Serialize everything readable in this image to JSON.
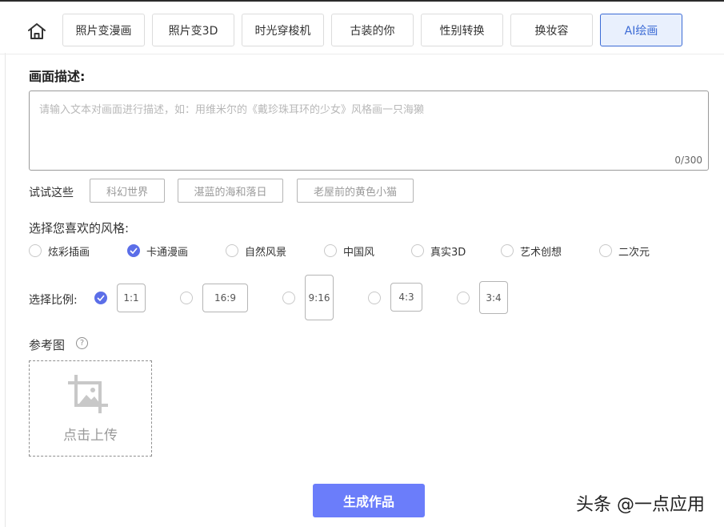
{
  "tabs": [
    {
      "label": "照片变漫画"
    },
    {
      "label": "照片变3D"
    },
    {
      "label": "时光穿梭机"
    },
    {
      "label": "古装的你"
    },
    {
      "label": "性别转换"
    },
    {
      "label": "换妆容"
    },
    {
      "label": "AI绘画",
      "active": true
    }
  ],
  "description": {
    "title": "画面描述:",
    "placeholder": "请输入文本对画面进行描述，如：用维米尔的《戴珍珠耳环的少女》风格画一只海獭",
    "value": "",
    "counter": "0/300"
  },
  "try": {
    "label": "试试这些",
    "chips": [
      "科幻世界",
      "湛蓝的海和落日",
      "老屋前的黄色小猫"
    ]
  },
  "style": {
    "title": "选择您喜欢的风格:",
    "options": [
      "炫彩插画",
      "卡通漫画",
      "自然风景",
      "中国风",
      "真实3D",
      "艺术创想",
      "二次元"
    ],
    "selected": "卡通漫画"
  },
  "ratio": {
    "label": "选择比例:",
    "options": [
      "1:1",
      "16:9",
      "9:16",
      "4:3",
      "3:4"
    ],
    "selected": "1:1"
  },
  "reference": {
    "title": "参考图",
    "help": "?",
    "upload_label": "点击上传"
  },
  "generate_label": "生成作品",
  "watermark": "头条 @一点应用",
  "colors": {
    "accent": "#6b7dfa",
    "radio_checked": "#5b6ee8",
    "active_tab_bg": "#e9f0fd",
    "active_tab_border": "#3c6bd5"
  },
  "icons": {
    "home": "home-icon",
    "check": "check-icon",
    "upload": "image-upload-icon",
    "help": "help-circle-icon"
  }
}
